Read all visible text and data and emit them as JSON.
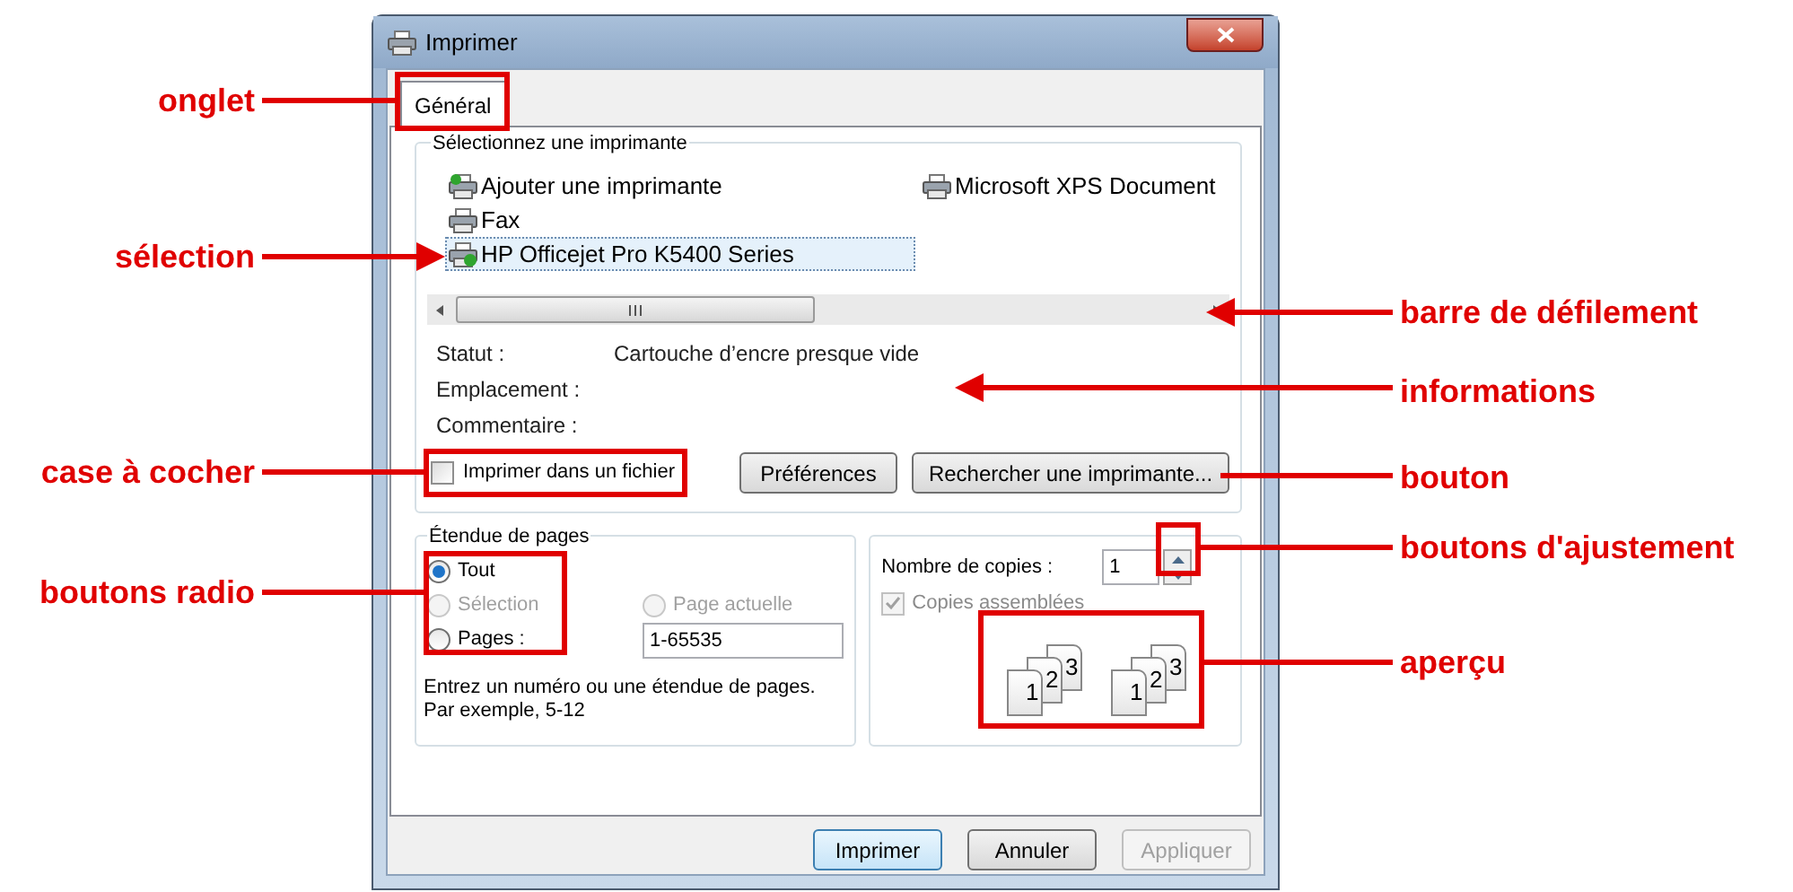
{
  "window": {
    "title": "Imprimer"
  },
  "tabs": [
    {
      "label": "Général",
      "selected": true
    }
  ],
  "printer_group": {
    "title": "Sélectionnez une imprimante",
    "printers": [
      {
        "name": "Ajouter une imprimante",
        "kind": "add",
        "selected": false
      },
      {
        "name": "Fax",
        "kind": "fax",
        "selected": false
      },
      {
        "name": "HP Officejet Pro K5400 Series",
        "kind": "default",
        "selected": true
      },
      {
        "name": "Microsoft XPS Document",
        "kind": "printer",
        "selected": false
      }
    ],
    "info": [
      {
        "label": "Statut :",
        "value": "Cartouche d’encre presque vide"
      },
      {
        "label": "Emplacement :"
      },
      {
        "label": "Commentaire :"
      }
    ],
    "print_to_file": {
      "label": "Imprimer dans un fichier",
      "checked": false
    },
    "buttons": [
      "Préférences",
      "Rechercher une imprimante..."
    ]
  },
  "page_range": {
    "title": "Étendue de pages",
    "options": [
      {
        "label": "Tout",
        "selected": true,
        "disabled": false
      },
      {
        "label": "Sélection",
        "selected": false,
        "disabled": true
      },
      {
        "label": "Page actuelle",
        "selected": false,
        "disabled": true
      },
      {
        "label": "Pages :",
        "selected": false,
        "disabled": false
      }
    ],
    "pages_value": "1-65535",
    "hint": [
      "Entrez un numéro ou une étendue de pages.",
      "Par exemple, 5-12"
    ]
  },
  "copies": {
    "label": "Nombre de copies :",
    "value": "1",
    "collate": {
      "label": "Copies assemblées",
      "checked": true,
      "disabled": true
    },
    "preview": [
      [
        "1",
        "2",
        "3"
      ],
      [
        "1",
        "2",
        "3"
      ]
    ]
  },
  "footer_buttons": [
    {
      "label": "Imprimer",
      "default": true,
      "disabled": false
    },
    {
      "label": "Annuler",
      "default": false,
      "disabled": false
    },
    {
      "label": "Appliquer",
      "default": false,
      "disabled": true
    }
  ],
  "left_callouts": [
    "onglet",
    "sélection",
    "case à cocher",
    "boutons radio"
  ],
  "right_callouts": [
    "barre de défilement",
    "informations",
    "bouton",
    "boutons d'ajustement",
    "aperçu"
  ]
}
